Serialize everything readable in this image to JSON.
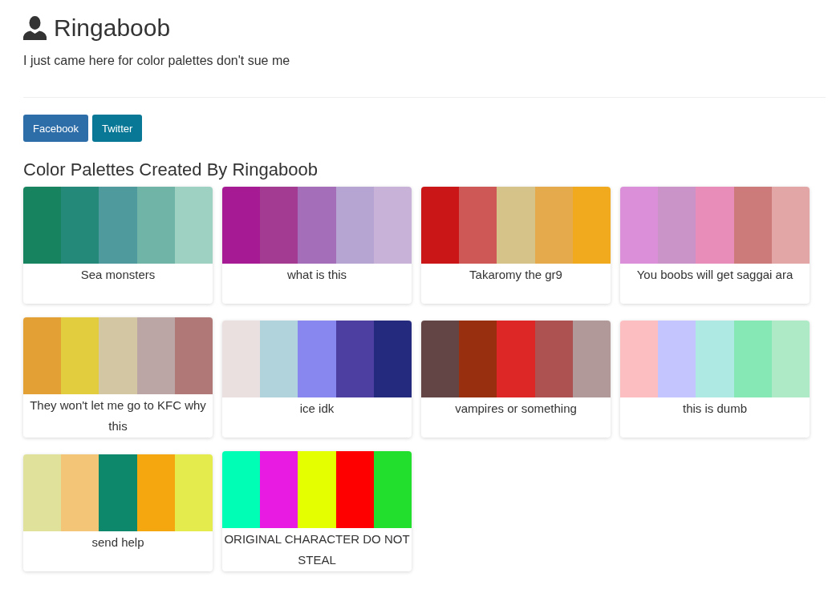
{
  "profile": {
    "name": "Ringaboob",
    "bio": "I just came here for color palettes don't sue me"
  },
  "social_buttons": [
    {
      "label": "Facebook",
      "kind": "facebook"
    },
    {
      "label": "Twitter",
      "kind": "twitter"
    }
  ],
  "section_title": "Color Palettes Created By Ringaboob",
  "palettes": [
    {
      "name": "Sea monsters",
      "colors": [
        {
          "color": "#17845f"
        },
        {
          "color": "#248979"
        },
        {
          "color": "#4f9a9c"
        },
        {
          "color": "#6fb4a7"
        },
        {
          "color": "#9ed1c2"
        }
      ]
    },
    {
      "name": "what is this",
      "colors": [
        {
          "color": "#a61a93"
        },
        {
          "color": "#a33b92"
        },
        {
          "color": "#a46eb8"
        },
        {
          "color": "#b6a5d2"
        },
        {
          "color": "#c8b2d8"
        }
      ]
    },
    {
      "name": "Takaromy the gr9",
      "colors": [
        {
          "color": "#ca1616"
        },
        {
          "color": "#cd5856"
        },
        {
          "color": "#d6c38a"
        },
        {
          "color": "#e4aa4b"
        },
        {
          "color": "#f1aa1e"
        }
      ]
    },
    {
      "name": "You boobs will get saggai ara",
      "colors": [
        {
          "color": "#db8fd8"
        },
        {
          "color": "#ca94c9"
        },
        {
          "color": "#e88dba"
        },
        {
          "color": "#cc7a7a"
        },
        {
          "color": "#e3a6a6"
        }
      ]
    },
    {
      "name": "They won't let me go to KFC why this",
      "colors": [
        {
          "color": "#e3a034"
        },
        {
          "color": "#e1cd3d"
        },
        {
          "color": "#d3c6a3"
        },
        {
          "color": "#bca6a5"
        },
        {
          "color": "#b17878"
        }
      ]
    },
    {
      "name": "ice idk",
      "colors": [
        {
          "color": "#eae0e0"
        },
        {
          "color": "#b1d3dc"
        },
        {
          "color": "#8787ef"
        },
        {
          "color": "#4d3fa2"
        },
        {
          "color": "#242a7e"
        }
      ]
    },
    {
      "name": "vampires or something",
      "colors": [
        {
          "color": "#634546"
        },
        {
          "color": "#98300f"
        },
        {
          "color": "#dd2727"
        },
        {
          "color": "#ae5151"
        },
        {
          "color": "#b09998"
        }
      ]
    },
    {
      "name": "this is dumb",
      "colors": [
        {
          "color": "#fdbec1"
        },
        {
          "color": "#c4c4fe"
        },
        {
          "color": "#aee9e4"
        },
        {
          "color": "#86e8b5"
        },
        {
          "color": "#aeeac6"
        }
      ]
    },
    {
      "name": "send help",
      "colors": [
        {
          "color": "#e0e19b"
        },
        {
          "color": "#f2c577"
        },
        {
          "color": "#0d886b"
        },
        {
          "color": "#f5a70f"
        },
        {
          "color": "#e4eb4d"
        }
      ]
    },
    {
      "name": "ORIGINAL CHARACTER DO NOT STEAL",
      "colors": [
        {
          "color": "#00ffb4"
        },
        {
          "color": "#e81be3"
        },
        {
          "color": "#e4ff00"
        },
        {
          "color": "#ff0000"
        },
        {
          "color": "#22de2d"
        }
      ]
    }
  ]
}
